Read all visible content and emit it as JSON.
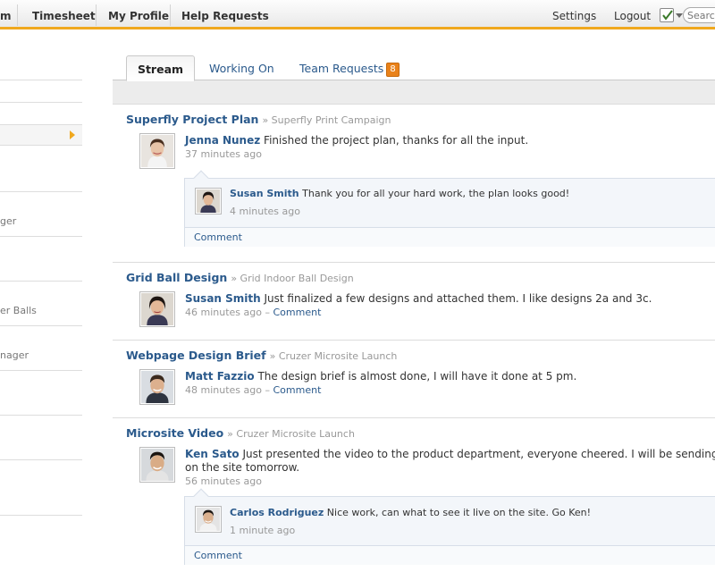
{
  "nav": {
    "items": [
      "m",
      "Timesheet",
      "My Profile",
      "Help Requests"
    ],
    "settings": "Settings",
    "logout": "Logout",
    "search_placeholder": "Search"
  },
  "sidebar": {
    "items": [
      "ger",
      "er Balls",
      "nager"
    ]
  },
  "tabs": {
    "stream": "Stream",
    "working_on": "Working On",
    "team_requests": "Team Requests",
    "team_requests_count": "8"
  },
  "stream": [
    {
      "project": "Superfly Project Plan",
      "context": "» Superfly Print Campaign",
      "author": "Jenna Nunez",
      "text": "Finished the project plan, thanks for all the input.",
      "time": "37 minutes ago",
      "comment": {
        "author": "Susan Smith",
        "text": "Thank you for all your hard work, the plan looks good!",
        "time": "4 minutes ago",
        "action": "Comment"
      }
    },
    {
      "project": "Grid Ball Design",
      "context": "» Grid Indoor Ball Design",
      "author": "Susan Smith",
      "text": "Just finalized a few designs and attached them.  I like designs 2a and 3c.",
      "time": "46 minutes ago",
      "sep": "–",
      "action": "Comment"
    },
    {
      "project": "Webpage Design Brief",
      "context": "» Cruzer Microsite Launch",
      "author": "Matt Fazzio",
      "text": "The design brief is almost done, I will have it done at 5 pm.",
      "time": "48 minutes ago",
      "sep": "–",
      "action": "Comment"
    },
    {
      "project": "Microsite Video",
      "context": "» Cruzer Microsite Launch",
      "author": "Ken Sato",
      "text": "Just presented the video to the product department, everyone cheered.  I will be sending this",
      "text2": "on the site tomorrow.",
      "time": "56 minutes ago",
      "comment": {
        "author": "Carlos Rodriguez",
        "text": "Nice work, can what to see it live on the site. Go Ken!",
        "time": "1 minute ago",
        "action": "Comment"
      }
    }
  ],
  "colors": {
    "accent": "#f0a81e",
    "link": "#2b5a8c",
    "badge": "#e9821a"
  },
  "icons": {
    "task": "task-checklist-icon",
    "arrow": "sidebar-arrow-icon"
  }
}
